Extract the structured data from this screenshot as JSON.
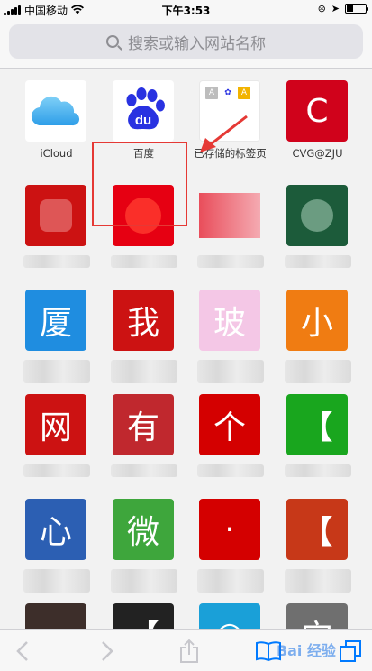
{
  "status": {
    "carrier": "中国移动",
    "time": "下午3:53",
    "battery_level": 0.35
  },
  "search": {
    "placeholder": "搜索或输入网站名称"
  },
  "favorites": [
    {
      "label": "iCloud",
      "icon": "icloud-icon"
    },
    {
      "label": "百度",
      "icon": "baidu-paw-icon",
      "icon_text": "du"
    },
    {
      "label": "已存储的标签页",
      "icon": "saved-tabs-icon",
      "mini": [
        "A",
        "✿",
        "A"
      ]
    },
    {
      "label": "CVG@ZJU",
      "icon_text": "C",
      "color": "#d0021b"
    },
    {
      "icon_text": "",
      "color": "#cc1212"
    },
    {
      "icon_text": "",
      "color": "#e60012"
    },
    {
      "icon_text": "",
      "color": "#e83b4a"
    },
    {
      "icon_text": "",
      "color": "#1c5b3a"
    },
    {
      "icon_text": "厦",
      "color": "#1f8de0"
    },
    {
      "icon_text": "我",
      "color": "#cc1212"
    },
    {
      "icon_text": "玻",
      "color": "#f4c7e6"
    },
    {
      "icon_text": "小",
      "color": "#f07c12"
    },
    {
      "icon_text": "网",
      "color": "#cc1212"
    },
    {
      "icon_text": "有",
      "color": "#c0282e"
    },
    {
      "icon_text": "个",
      "color": "#d40000"
    },
    {
      "icon_text": "【",
      "color": "#19a61e"
    },
    {
      "icon_text": "心",
      "color": "#2c5fb3"
    },
    {
      "icon_text": "微",
      "color": "#3ea63c"
    },
    {
      "icon_text": "·",
      "color": "#d40000"
    },
    {
      "icon_text": "【",
      "color": "#c73818"
    },
    {
      "icon_text": "",
      "color": "#3d2e2a"
    },
    {
      "icon_text": "【",
      "color": "#222222"
    },
    {
      "icon_text": "○",
      "color": "#1aa0d8"
    },
    {
      "icon_text": "宀",
      "color": "#6f6f6f"
    }
  ],
  "toolbar": {
    "back_icon": "chevron-left-icon",
    "forward_icon": "chevron-right-icon",
    "share_icon": "share-icon",
    "bookmarks_icon": "book-icon",
    "tabs_icon": "tabs-icon",
    "watermark": "Bai 经验"
  },
  "colors": {
    "accent": "#007aff",
    "highlight": "#e53935"
  }
}
